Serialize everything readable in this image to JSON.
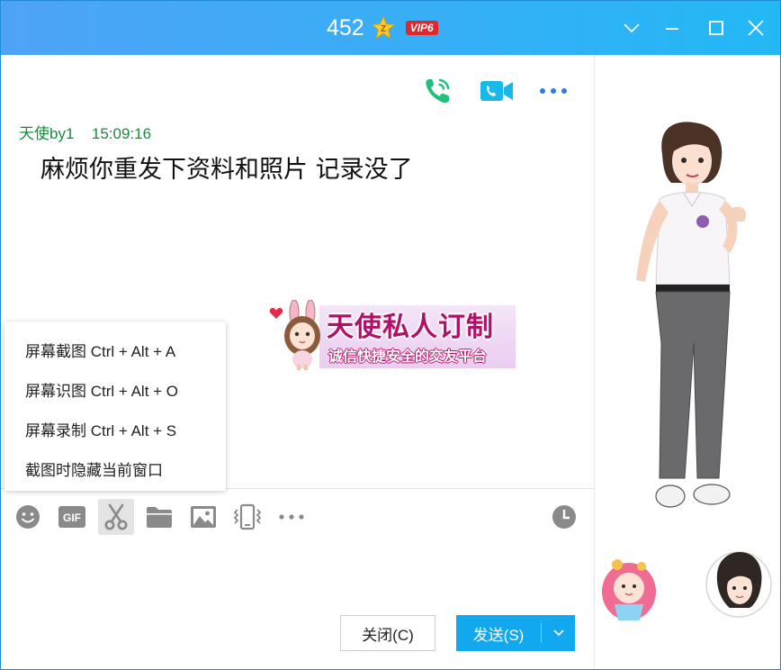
{
  "window": {
    "title": "452",
    "vip_label": "VIP6",
    "controls": [
      "collapse",
      "minimize",
      "maximize",
      "close"
    ]
  },
  "chat": {
    "toolbar_icons": [
      "phone-icon",
      "video-call-icon",
      "more-icon"
    ],
    "message": {
      "sender": "天使by1",
      "time": "15:09:16",
      "text": "麻烦你重发下资料和照片  记录没了"
    },
    "banner": {
      "title": "天使私人订制",
      "subtitle": "诚信快捷安全的交友平台"
    }
  },
  "menu": {
    "items": [
      {
        "label": "屏幕截图 Ctrl + Alt + A"
      },
      {
        "label": "屏幕识图 Ctrl + Alt + O"
      },
      {
        "label": "屏幕录制 Ctrl + Alt + S"
      },
      {
        "label": "截图时隐藏当前窗口"
      }
    ]
  },
  "input_toolbar": {
    "gif_label": "GIF",
    "icons": [
      "emoji-icon",
      "gif-icon",
      "scissors-icon",
      "folder-icon",
      "image-icon",
      "vibrate-icon",
      "more-icon",
      "history-icon"
    ]
  },
  "buttons": {
    "close_label": "关闭(C)",
    "send_label": "发送(S)"
  },
  "colors": {
    "title_gradient_start": "#4fa3f7",
    "title_gradient_end": "#23b8f5",
    "send_button": "#12a8ef",
    "sender_name": "#1a8a3e",
    "vip_badge": "#e3262a"
  }
}
